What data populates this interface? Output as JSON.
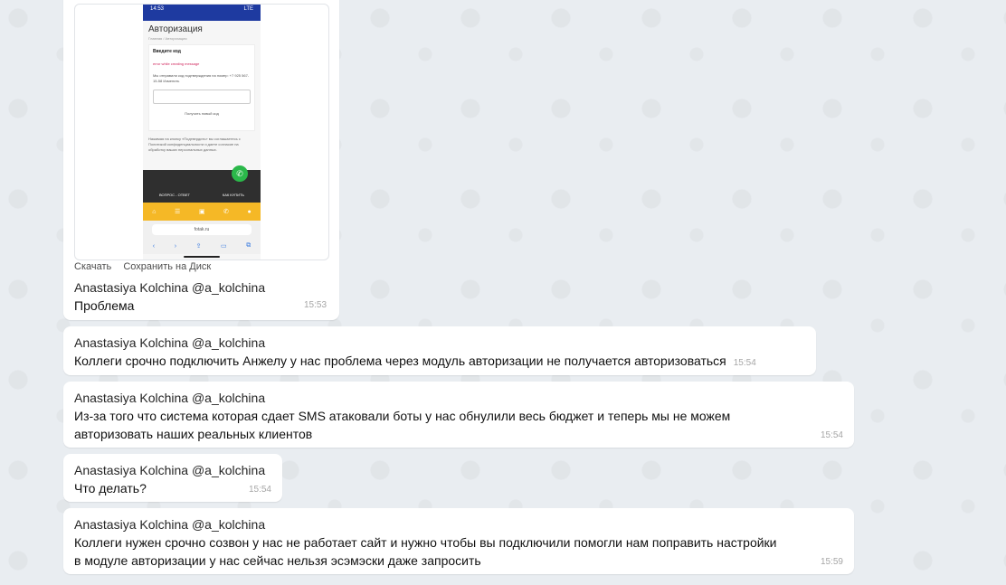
{
  "messages": [
    {
      "sender": "Anastasiya Kolchina @a_kolchina",
      "text": "Проблема",
      "time": "15:53",
      "attachment_actions": {
        "download": "Скачать",
        "save_to_disk": "Сохранить на Диск"
      },
      "screenshot": {
        "status_time": "14:53",
        "status_icons": "LTE",
        "page_title": "Авторизация",
        "breadcrumb": "Главная / Авторизация",
        "card_heading": "Введите код",
        "error_text": "error while creating message",
        "sent_text": "Мы отправили код подтверждения на номер: +7 925 567-15-58 Изменить",
        "new_code_link": "Получить новый код",
        "consent_note": "Нажимая на кнопку «Подтвердить» вы соглашаетесь с Политикой конфиденциальности и даете согласие на обработку ваших персональных данных.",
        "footer_left": "ВОПРОС - ОТВЕТ",
        "footer_right": "КАК КУПИТЬ",
        "url": "fotak.ru"
      }
    },
    {
      "sender": "Anastasiya Kolchina @a_kolchina",
      "text": "Коллеги срочно подключить Анжелу у нас проблема через модуль авторизации не получается авторизоваться",
      "time": "15:54"
    },
    {
      "sender": "Anastasiya Kolchina @a_kolchina",
      "text_line1": "Из-за того что система которая сдает SMS атаковали боты у нас обнулили весь бюджет и теперь мы не можем",
      "text_line2": "авторизовать наших реальных клиентов",
      "time": "15:54"
    },
    {
      "sender": "Anastasiya Kolchina @a_kolchina",
      "text": "Что делать?",
      "time": "15:54"
    },
    {
      "sender": "Anastasiya Kolchina @a_kolchina",
      "text_line1": "Коллеги нужен срочно созвон у нас не работает сайт и нужно чтобы вы подключили помогли нам поправить настройки",
      "text_line2": "в модуле авторизации у нас сейчас нельзя эсэмэски даже запросить",
      "time": "15:59"
    }
  ]
}
